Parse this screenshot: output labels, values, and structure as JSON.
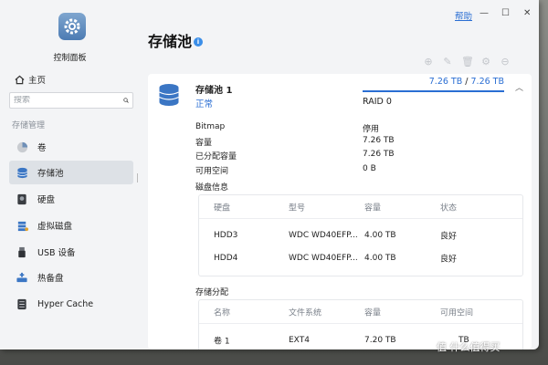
{
  "app": {
    "title": "控制面板",
    "help": "帮助",
    "minimize": "—",
    "maximize": "☐",
    "close": "✕"
  },
  "sidebar": {
    "home": "主页",
    "search_placeholder": "搜索",
    "section": "存储管理",
    "items": [
      {
        "label": "卷",
        "icon": "volume-pie-icon",
        "active": false
      },
      {
        "label": "存储池",
        "icon": "storage-pool-icon",
        "active": true
      },
      {
        "label": "硬盘",
        "icon": "hdd-icon",
        "active": false
      },
      {
        "label": "虚拟磁盘",
        "icon": "virtual-disk-icon",
        "active": false
      },
      {
        "label": "USB 设备",
        "icon": "usb-icon",
        "active": false
      },
      {
        "label": "热备盘",
        "icon": "hot-spare-icon",
        "active": false
      },
      {
        "label": "Hyper Cache",
        "icon": "cache-icon",
        "active": false
      }
    ]
  },
  "main": {
    "title": "存储池",
    "toolbar_icons": [
      "add-icon",
      "edit-icon",
      "delete-icon",
      "settings-icon",
      "more-icon"
    ]
  },
  "pool": {
    "name": "存储池 1",
    "status": "正常",
    "used": "7.26 TB",
    "separator": " / ",
    "total": "7.26 TB",
    "usage_fraction": 1.0,
    "raid": "RAID 0",
    "props": [
      {
        "key": "Bitmap",
        "value": "停用"
      },
      {
        "key": "容量",
        "value": "7.26 TB"
      },
      {
        "key": "已分配容量",
        "value": "7.26 TB"
      },
      {
        "key": "可用空间",
        "value": "0 B"
      }
    ],
    "disk_info_title": "磁盘信息",
    "disk_table": {
      "headers": [
        "硬盘",
        "型号",
        "容量",
        "状态"
      ],
      "rows": [
        [
          "HDD3",
          "WDC WD40EFP...",
          "4.00 TB",
          "良好"
        ],
        [
          "HDD4",
          "WDC WD40EFP...",
          "4.00 TB",
          "良好"
        ]
      ]
    },
    "alloc_title": "存储分配",
    "alloc_table": {
      "headers": [
        "名称",
        "文件系统",
        "容量",
        "可用空间"
      ],
      "rows": [
        [
          "卷 1",
          "EXT4",
          "7.20 TB",
          "TB"
        ]
      ]
    }
  },
  "watermark": "值 什么值得买",
  "colors": {
    "accent": "#2a6ed3",
    "sidebar_active": "#dde1e6",
    "background": "#f3f4f6"
  }
}
